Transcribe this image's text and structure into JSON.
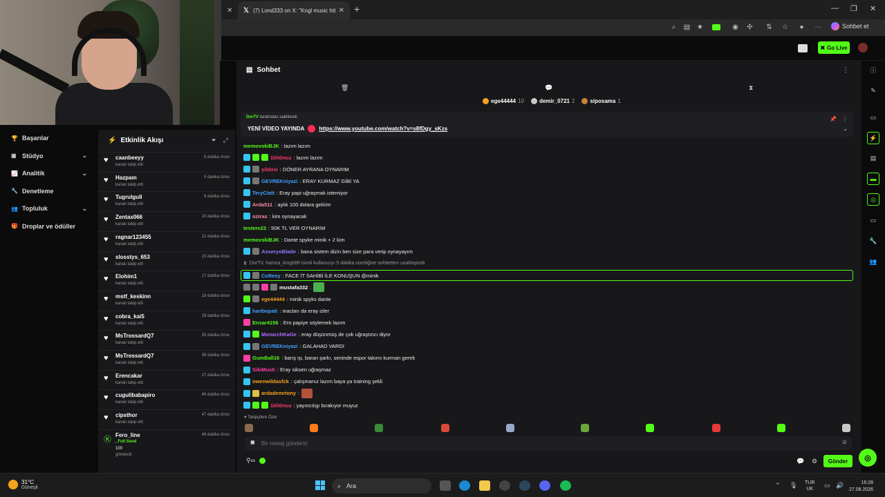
{
  "browser": {
    "tab_x_title": "(7) Lond333 on X: \"Kngl music htt",
    "toolbar_profile_label": "Sohbet et"
  },
  "header": {
    "go_live_label": "Go Live"
  },
  "leftnav": {
    "items": [
      {
        "label": "Başarılar",
        "icon": "trophy-icon",
        "chevron": false
      },
      {
        "label": "Stüdyo",
        "icon": "studio-icon",
        "chevron": true
      },
      {
        "label": "Analitik",
        "icon": "analytics-icon",
        "chevron": true
      },
      {
        "label": "Denetleme",
        "icon": "moderation-icon",
        "chevron": false
      },
      {
        "label": "Topluluk",
        "icon": "community-icon",
        "chevron": true
      },
      {
        "label": "Droplar ve ödüller",
        "icon": "gift-icon",
        "chevron": false
      }
    ]
  },
  "activity": {
    "title": "Etkinlik Akışı",
    "items": [
      {
        "user": "caanbeeyy",
        "sub": "kanalı takip etti",
        "time": "5 dakika önce"
      },
      {
        "user": "Hazpam",
        "sub": "kanalı takip etti",
        "time": "5 dakika önce"
      },
      {
        "user": "Tugrulgull",
        "sub": "kanalı takip etti",
        "time": "9 dakika önce"
      },
      {
        "user": "Zentax066",
        "sub": "kanalı takip etti",
        "time": "10 dakika önce"
      },
      {
        "user": "ragnar123455",
        "sub": "kanalı takip etti",
        "time": "12 dakika önce"
      },
      {
        "user": "slosstys_653",
        "sub": "kanalı takip etti",
        "time": "15 dakika önce"
      },
      {
        "user": "Elohim1",
        "sub": "kanalı takip etti",
        "time": "17 dakika önce"
      },
      {
        "user": "mstf_keskinn",
        "sub": "kanalı takip etti",
        "time": "18 dakika önce"
      },
      {
        "user": "cobra_kai5",
        "sub": "kanalı takip etti",
        "time": "29 dakika önce"
      },
      {
        "user": "MsTrossardQ7",
        "sub": "kanalı takip etti",
        "time": "35 dakika önce"
      },
      {
        "user": "MsTrossardQ7",
        "sub": "kanalı takip etti",
        "time": "36 dakika önce"
      },
      {
        "user": "Erencakar",
        "sub": "kanalı takip etti",
        "time": "37 dakika önce"
      },
      {
        "user": "cugulibabapiro",
        "sub": "kanalı takip etti",
        "time": "46 dakika önce"
      },
      {
        "user": "cipsthor",
        "sub": "kanalı takip etti",
        "time": "47 dakika önce"
      }
    ],
    "fero": {
      "user": "Fero_line",
      "line1": ", Full Send",
      "line2": "100",
      "line3": "gönderdi",
      "time": "48 dakika önce"
    }
  },
  "chat": {
    "title": "Sohbet",
    "leaderboard": [
      {
        "name": "ege44444",
        "count": "10",
        "color": "#f6a21c"
      },
      {
        "name": "demir_0721",
        "count": "2",
        "color": "#c9c9c9"
      },
      {
        "name": "siposama",
        "count": "1",
        "color": "#c8843a"
      }
    ],
    "pinned": {
      "by_user": "DorTV",
      "by_suffix": "tarafından sabitlendi",
      "prefix": "YENİ VİDEO YAYINDA",
      "link": "https://www.youtube.com/watch?v=s8fDgy_sKzs"
    },
    "messages": [
      {
        "badges": [],
        "nick": "memovskiBJK",
        "color": "#53fc18",
        "text": ": lazım lazım"
      },
      {
        "badges": [
          "sub",
          "mod",
          "b-mod2"
        ],
        "nick": "1kh0nsu",
        "color": "#ff3b6b",
        "text": ": lazım lazım"
      },
      {
        "badges": [
          "sub",
          "gray"
        ],
        "nick": "yildosi",
        "color": "#ff3b6b",
        "text": ": DÖNER AYRANA OYNARIM"
      },
      {
        "badges": [
          "sub",
          "gray"
        ],
        "nick": "GEVREKniyazi",
        "color": "#3fa2ff",
        "text": ": ERAY KURMAZ GİBİ YA"
      },
      {
        "badges": [
          "sub"
        ],
        "nick": "TeryClatt",
        "color": "#3fa2ff",
        "text": ": Eray papi uğraşmak istemiyor"
      },
      {
        "badges": [
          "sub"
        ],
        "nick": "Arda511",
        "color": "#ff8aa8",
        "text": ": aylık 100 dolara gelirim"
      },
      {
        "badges": [
          "sub"
        ],
        "nick": "oziras",
        "color": "#ff8aa8",
        "text": ": kim oynayacak"
      },
      {
        "badges": [],
        "nick": "testere23",
        "color": "#53fc18",
        "text": ": 50K TL VER OYNARIM"
      },
      {
        "badges": [],
        "nick": "memovskiBJK",
        "color": "#53fc18",
        "text": ": Dante spyke minik + 2 kim"
      },
      {
        "badges": [
          "sub",
          "gray"
        ],
        "nick": "AsseryoBlade",
        "color": "#8e7cff",
        "text": ": bana sistem dizin ben size para verip oynayayım"
      }
    ],
    "system_msg": "DorTV, hamza_king089 isimli kullanıcıyı 5 dakika süreliğine sohbetten uzaklaştırdı",
    "highlight_msg": {
      "nick": "Cofteey",
      "color": "#3fa2ff",
      "text": ": FACE İT SAHİBİ İLE KONUŞUN @minik"
    },
    "messages2": [
      {
        "badges": [
          "gray",
          "gray",
          "vip",
          "gray"
        ],
        "nick": "mustafa332",
        "color": "#ffffff",
        "text": ":",
        "emote": "#4caf50"
      },
      {
        "badges": [
          "mod",
          "gray"
        ],
        "nick": "ege44444",
        "color": "#f6a21c",
        "text": ": minik spyks dante"
      },
      {
        "badges": [
          "sub"
        ],
        "nick": "haribopati",
        "color": "#3fa2ff",
        "text": ": macları da eray izler"
      },
      {
        "badges": [
          "vip"
        ],
        "nick": "Ensar4156",
        "color": "#53fc18",
        "text": ": Ero papiye söylemek lazım"
      },
      {
        "badges": [
          "sub",
          "mod"
        ],
        "nick": "MonarchKaGe",
        "color": "#b06cff",
        "text": ": eray düşünmüş de çok uğraştıncı diyor"
      },
      {
        "badges": [
          "sub",
          "gray"
        ],
        "nick": "GEVREKniyazi",
        "color": "#3fa2ff",
        "text": ": GALAHAD VARDI"
      },
      {
        "badges": [
          "vip"
        ],
        "nick": "GumBall16",
        "color": "#53fc18",
        "text": ": barış rp, baran şarkı, seninde espor takımı kurman gerek"
      },
      {
        "badges": [
          "sub"
        ],
        "nick": "SikiMusti",
        "color": "#ff3ea5",
        "text": ": Eray siksen uğraşmaz"
      },
      {
        "badges": [
          "sub"
        ],
        "nick": "owenwildasfck",
        "color": "#f6a21c",
        "text": ": çalışmanız lazım baya ya training şekli"
      },
      {
        "badges": [
          "sub",
          "gift"
        ],
        "nick": "ardademrtony",
        "color": "#f6a21c",
        "text": ":",
        "emote": "#b5523b"
      },
      {
        "badges": [
          "sub",
          "mod",
          "b-mod2"
        ],
        "nick": "1kh0nsu",
        "color": "#ff3b6b",
        "text": ": yayıncılıgı bırakıyor muyuz"
      }
    ],
    "tip_label": "Takipçilere Özel",
    "input_placeholder": "Bir mesaj gönderin",
    "send_label": "Gönder"
  },
  "taskbar": {
    "temp": "31°C",
    "weather": "Güneşli",
    "search_label": "Ara",
    "lang1": "TUR",
    "lang2": "UK",
    "time": "16:28",
    "date": "27.08.2026"
  }
}
